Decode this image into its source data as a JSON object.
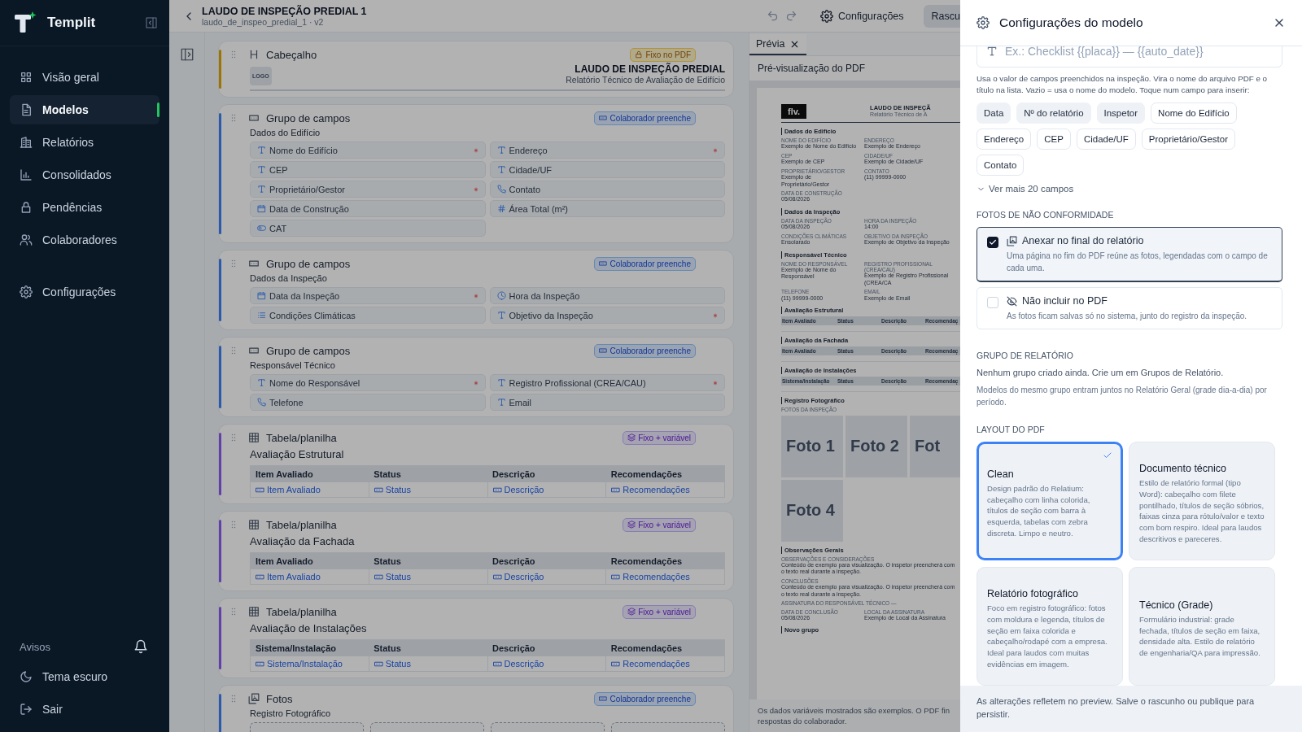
{
  "sidebar": {
    "brand": "Templit",
    "items": [
      {
        "label": "Visão geral",
        "selected": false
      },
      {
        "label": "Modelos",
        "selected": true
      },
      {
        "label": "Relatórios",
        "selected": false
      },
      {
        "label": "Consolidados",
        "selected": false
      },
      {
        "label": "Pendências",
        "selected": false
      },
      {
        "label": "Colaboradores",
        "selected": false
      }
    ],
    "settings": {
      "label": "Configurações",
      "selected": false
    },
    "notices": "Avisos",
    "footer_items": [
      {
        "label": "Tema escuro"
      },
      {
        "label": "Sair"
      }
    ]
  },
  "topbar": {
    "title": "LAUDO DE INSPEÇÃO PREDIAL 1",
    "subtitle": "laudo_de_inspeo_predial_1 · v2",
    "settings_button": "Configurações",
    "draft_button": "Rascu"
  },
  "blocks": [
    {
      "kind": "header",
      "type_label": "Cabeçalho",
      "badge": {
        "kind": "fixed",
        "label": "Fixo no PDF"
      },
      "logo": "LOGO",
      "title": "LAUDO DE INSPEÇÃO PREDIAL",
      "subtitle": "Relatório Técnico de Avaliação de Edifício"
    },
    {
      "kind": "fields",
      "type_label": "Grupo de campos",
      "badge": {
        "kind": "collaborator",
        "label": "Colaborador preenche"
      },
      "name": "Dados do Edifício",
      "fields": [
        {
          "label": "Nome do Edifício",
          "kind": "text",
          "required": true
        },
        {
          "label": "Endereço",
          "kind": "text",
          "required": true
        },
        {
          "label": "CEP",
          "kind": "text",
          "required": false
        },
        {
          "label": "Cidade/UF",
          "kind": "text",
          "required": false
        },
        {
          "label": "Proprietário/Gestor",
          "kind": "text",
          "required": true
        },
        {
          "label": "Contato",
          "kind": "phone",
          "required": false
        },
        {
          "label": "Data de Construção",
          "kind": "date",
          "required": false
        },
        {
          "label": "Área Total (m²)",
          "kind": "number",
          "required": false
        },
        {
          "label": "CAT",
          "kind": "toggle",
          "required": false
        }
      ]
    },
    {
      "kind": "fields",
      "type_label": "Grupo de campos",
      "badge": {
        "kind": "collaborator",
        "label": "Colaborador preenche"
      },
      "name": "Dados da Inspeção",
      "fields": [
        {
          "label": "Data da Inspeção",
          "kind": "date",
          "required": true
        },
        {
          "label": "Hora da Inspeção",
          "kind": "time",
          "required": false
        },
        {
          "label": "Condições Climáticas",
          "kind": "list",
          "required": false
        },
        {
          "label": "Objetivo da Inspeção",
          "kind": "text",
          "required": true
        }
      ]
    },
    {
      "kind": "fields",
      "type_label": "Grupo de campos",
      "badge": {
        "kind": "collaborator",
        "label": "Colaborador preenche"
      },
      "name": "Responsável Técnico",
      "fields": [
        {
          "label": "Nome do Responsável",
          "kind": "text",
          "required": true
        },
        {
          "label": "Registro Profissional (CREA/CAU)",
          "kind": "text",
          "required": true
        },
        {
          "label": "Telefone",
          "kind": "phone",
          "required": false
        },
        {
          "label": "Email",
          "kind": "text",
          "required": false
        }
      ]
    },
    {
      "kind": "table",
      "type_label": "Tabela/planilha",
      "badge": {
        "kind": "mixed",
        "label": "Fixo + variável"
      },
      "name": "Avaliação Estrutural",
      "columns": [
        "Item Avaliado",
        "Status",
        "Descrição",
        "Recomendações"
      ],
      "cells": [
        "Item Avaliado",
        "Status",
        "Descrição",
        "Recomendações"
      ]
    },
    {
      "kind": "table",
      "type_label": "Tabela/planilha",
      "badge": {
        "kind": "mixed",
        "label": "Fixo + variável"
      },
      "name": "Avaliação da Fachada",
      "columns": [
        "Item Avaliado",
        "Status",
        "Descrição",
        "Recomendações"
      ],
      "cells": [
        "Item Avaliado",
        "Status",
        "Descrição",
        "Recomendações"
      ]
    },
    {
      "kind": "table",
      "type_label": "Tabela/planilha",
      "badge": {
        "kind": "mixed",
        "label": "Fixo + variável"
      },
      "name": "Avaliação de Instalações",
      "columns": [
        "Sistema/Instalação",
        "Status",
        "Descrição",
        "Recomendações"
      ],
      "cells": [
        "Sistema/Instalação",
        "Status",
        "Descrição",
        "Recomendações"
      ]
    },
    {
      "kind": "photos",
      "type_label": "Fotos",
      "badge": {
        "kind": "collaborator",
        "label": "Colaborador preenche"
      },
      "name": "Registro Fotográfico"
    }
  ],
  "preview": {
    "tab": "Prévia",
    "title": "Pré-visualização do PDF",
    "page": {
      "logo": "flv.",
      "title": "LAUDO DE INSPEÇÃ",
      "subtitle": "Relatório Técnico de A",
      "sections": [
        {
          "kind": "fields",
          "title": "Dados do Edifício",
          "fields": [
            {
              "label": "NOME DO EDIFÍCIO",
              "value": "Exemplo de Nome do Edifício",
              "wide": false
            },
            {
              "label": "ENDEREÇO",
              "value": "Exemplo de Endereço",
              "wide": false
            },
            {
              "label": "CEP",
              "value": "Exemplo de CEP",
              "wide": false
            },
            {
              "label": "CIDADE/UF",
              "value": "Exemplo de Cidade/UF",
              "wide": false
            },
            {
              "label": "PROPRIETÁRIO/GESTOR",
              "value": "Exemplo de Proprietário/Gestor",
              "wide": false
            },
            {
              "label": "CONTATO",
              "value": "(11) 99999-0000",
              "wide": false
            },
            {
              "label": "DATA DE CONSTRUÇÃO",
              "value": "05/08/2026",
              "wide": false
            }
          ]
        },
        {
          "kind": "fields",
          "title": "Dados da Inspeção",
          "fields": [
            {
              "label": "DATA DA INSPEÇÃO",
              "value": "05/08/2026",
              "wide": false
            },
            {
              "label": "HORA DA INSPEÇÃO",
              "value": "14:00",
              "wide": false
            },
            {
              "label": "CONDIÇÕES CLIMÁTICAS",
              "value": "Ensolarado",
              "wide": false
            },
            {
              "label": "OBJETIVO DA INSPEÇÃO",
              "value": "Exemplo de Objetivo da Inspeção",
              "wide": false
            }
          ]
        },
        {
          "kind": "fields",
          "title": "Responsável Técnico",
          "fields": [
            {
              "label": "NOME DO RESPONSÁVEL",
              "value": "Exemplo de Nome do Responsável",
              "wide": false
            },
            {
              "label": "REGISTRO PROFISSIONAL (CREA/CAU)",
              "value": "Exemplo de Registro Profissional (CREA/CA",
              "wide": false
            },
            {
              "label": "TELEFONE",
              "value": "(11) 99999-0000",
              "wide": false
            },
            {
              "label": "EMAIL",
              "value": "Exemplo de Email",
              "wide": false
            }
          ]
        },
        {
          "kind": "table",
          "title": "Avaliação Estrutural",
          "columns": [
            "Item Avaliado",
            "Status",
            "Descrição",
            "Recomendaç"
          ]
        },
        {
          "kind": "table",
          "title": "Avaliação da Fachada",
          "columns": [
            "Item Avaliado",
            "Status",
            "Descrição",
            "Recomendaç"
          ]
        },
        {
          "kind": "table",
          "title": "Avaliação de Instalações",
          "columns": [
            "Sistema/Instalação",
            "Status",
            "Descrição",
            "Recomendaç"
          ]
        },
        {
          "kind": "photos",
          "title": "Registro Fotográfico",
          "label": "FOTOS DA INSPEÇÃO",
          "photos": [
            "Foto 1",
            "Foto 2",
            "Fot",
            "Foto 4"
          ]
        },
        {
          "kind": "fields",
          "title": "Observações Gerais",
          "fields": [
            {
              "label": "OBSERVAÇÕES E CONSIDERAÇÕES",
              "value": "Conteúdo de exemplo para visualização. O inspetor preencherá com o texto real durante a inspeção.",
              "wide": true
            },
            {
              "label": "CONCLUSÕES",
              "value": "Conteúdo de exemplo para visualização. O inspetor preencherá com o texto real durante a inspeção.",
              "wide": true
            },
            {
              "label": "ASSINATURA DO RESPONSÁVEL TÉCNICO —",
              "wide": true
            },
            {
              "label": "DATA DE CONCLUSÃO",
              "value": "05/08/2026",
              "wide": false
            },
            {
              "label": "LOCAL DA ASSINATURA",
              "value": "Exemplo de Local da Assinatura",
              "wide": false
            }
          ]
        },
        {
          "kind": "empty",
          "title": "Novo grupo"
        }
      ]
    },
    "note": [
      "Os dados variáveis mostrados são exemplos. O PDF fin",
      "respostas do colaborador."
    ]
  },
  "drawer": {
    "title": "Configurações do modelo",
    "name_field": {
      "placeholder": "Ex.: Checklist {{placa}} — {{auto_date}}"
    },
    "help": "Usa o valor de campos preenchidos na inspeção. Vira o nome do arquivo PDF e o título na lista. Vazio = usa o nome do modelo. Toque num campo para inserir:",
    "chips": [
      {
        "label": "Data",
        "kind": "system"
      },
      {
        "label": "Nº do relatório",
        "kind": "system"
      },
      {
        "label": "Inspetor",
        "kind": "system"
      },
      {
        "label": "Nome do Edifício",
        "kind": "field"
      },
      {
        "label": "Endereço",
        "kind": "field"
      },
      {
        "label": "CEP",
        "kind": "field"
      },
      {
        "label": "Cidade/UF",
        "kind": "field"
      },
      {
        "label": "Proprietário/Gestor",
        "kind": "field"
      },
      {
        "label": "Contato",
        "kind": "field"
      }
    ],
    "more": "Ver mais 20 campos",
    "photos_section": {
      "heading": "FOTOS DE NÃO CONFORMIDADE",
      "options": [
        {
          "title": "Anexar no final do relatório",
          "description": "Uma página no fim do PDF reúne as fotos, legendadas com o campo de cada uma.",
          "checked": true
        },
        {
          "title": "Não incluir no PDF",
          "description": "As fotos ficam salvas só no sistema, junto do registro da inspeção.",
          "checked": false
        }
      ]
    },
    "group_section": {
      "heading": "GRUPO DE RELATÓRIO",
      "empty": "Nenhum grupo criado ainda. Crie um em Grupos de Relatório.",
      "help": "Modelos do mesmo grupo entram juntos no Relatório Geral (grade dia-a-dia) por período."
    },
    "layout_section": {
      "heading": "LAYOUT DO PDF",
      "options": [
        {
          "title": "Clean",
          "description": "Design padrão do Relatium: cabeçalho com linha colorida, títulos de seção com barra à esquerda, tabelas com zebra discreta. Limpo e neutro.",
          "selected": true
        },
        {
          "title": "Documento técnico",
          "description": "Estilo de relatório formal (tipo Word): cabeçalho com filete pontilhado, títulos de seção sóbrios, faixas cinza para rótulo/valor e texto com bom respiro. Ideal para laudos descritivos e pareceres.",
          "selected": false
        },
        {
          "title": "Relatório fotográfico",
          "description": "Foco em registro fotográfico: fotos com moldura e legenda, títulos de seção em faixa colorida e cabeçalho/rodapé com a empresa. Ideal para laudos com muitas evidências em imagem.",
          "selected": false
        },
        {
          "title": "Técnico (Grade)",
          "description": "Formulário industrial: grade fechada, títulos de seção em faixa, densidade alta. Estilo de relatório de engenharia/QA para impressão.",
          "selected": false
        }
      ]
    },
    "footer": "As alterações refletem no preview. Salve o rascunho ou publique para persistir."
  }
}
